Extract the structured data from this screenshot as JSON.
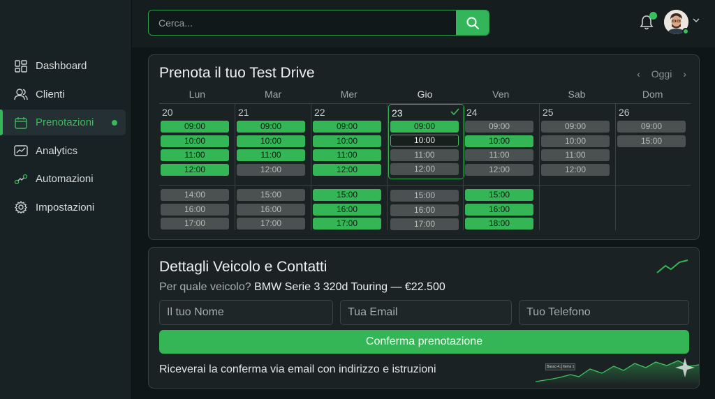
{
  "search": {
    "placeholder": "Cerca..."
  },
  "sidebar": {
    "items": [
      {
        "label": "Dashboard",
        "icon": "dashboard-icon",
        "active": false
      },
      {
        "label": "Clienti",
        "icon": "users-icon",
        "active": false
      },
      {
        "label": "Prenotazioni",
        "icon": "calendar-icon",
        "active": true
      },
      {
        "label": "Analytics",
        "icon": "analytics-icon",
        "active": false
      },
      {
        "label": "Automazioni",
        "icon": "automation-icon",
        "active": false
      },
      {
        "label": "Impostazioni",
        "icon": "gear-icon",
        "active": false
      }
    ]
  },
  "calendar": {
    "title": "Prenota il tuo Test Drive",
    "today_label": "Oggi",
    "prev_icon": "chevron-left-icon",
    "next_icon": "chevron-right-icon",
    "days": [
      {
        "name": "Lun",
        "num": "20",
        "morning": [
          [
            "09:00",
            "avail"
          ],
          [
            "10:00",
            "avail"
          ],
          [
            "11:00",
            "avail"
          ],
          [
            "12:00",
            "avail"
          ]
        ],
        "afternoon": [
          [
            "14:00",
            "busy"
          ],
          [
            "16:00",
            "busy"
          ],
          [
            "17:00",
            "busy"
          ]
        ]
      },
      {
        "name": "Mar",
        "num": "21",
        "morning": [
          [
            "09:00",
            "avail"
          ],
          [
            "10:00",
            "avail"
          ],
          [
            "11:00",
            "avail"
          ],
          [
            "12:00",
            "busy"
          ]
        ],
        "afternoon": [
          [
            "15:00",
            "busy"
          ],
          [
            "16:00",
            "busy"
          ],
          [
            "17:00",
            "busy"
          ]
        ]
      },
      {
        "name": "Mer",
        "num": "22",
        "morning": [
          [
            "09:00",
            "avail"
          ],
          [
            "10:00",
            "avail"
          ],
          [
            "11:00",
            "avail"
          ],
          [
            "12:00",
            "avail"
          ]
        ],
        "afternoon": [
          [
            "15:00",
            "avail"
          ],
          [
            "16:00",
            "avail"
          ],
          [
            "17:00",
            "avail"
          ]
        ]
      },
      {
        "name": "Gio",
        "num": "23",
        "selected": true,
        "morning": [
          [
            "09:00",
            "avail"
          ],
          [
            "10:00",
            "selected"
          ],
          [
            "11:00",
            "busy"
          ],
          [
            "12:00",
            "busy"
          ]
        ],
        "afternoon": [
          [
            "15:00",
            "busy"
          ],
          [
            "16:00",
            "busy"
          ],
          [
            "17:00",
            "busy"
          ]
        ]
      },
      {
        "name": "Ven",
        "num": "24",
        "morning": [
          [
            "09:00",
            "busy"
          ],
          [
            "10:00",
            "avail"
          ],
          [
            "11:00",
            "busy"
          ],
          [
            "12:00",
            "busy"
          ]
        ],
        "afternoon": [
          [
            "15:00",
            "avail"
          ],
          [
            "16:00",
            "avail"
          ],
          [
            "18:00",
            "avail"
          ]
        ]
      },
      {
        "name": "Sab",
        "num": "25",
        "morning": [
          [
            "09:00",
            "busy"
          ],
          [
            "10:00",
            "busy"
          ],
          [
            "11:00",
            "busy"
          ],
          [
            "12:00",
            "busy"
          ]
        ],
        "afternoon": []
      },
      {
        "name": "Dom",
        "num": "26",
        "morning": [
          [
            "09:00",
            "busy"
          ],
          [
            "15:00",
            "busy"
          ]
        ],
        "afternoon": []
      }
    ]
  },
  "form": {
    "title": "Dettagli Veicolo e Contatti",
    "vehicle_question": "Per quale veicolo?",
    "vehicle_value": "BMW Serie 3 320d Touring — €22.500",
    "name_placeholder": "Il tuo Nome",
    "email_placeholder": "Tua Email",
    "phone_placeholder": "Tuo Telefono",
    "confirm_label": "Conferma prenotazione",
    "note": "Riceverai la conferma via email con indirizzo e istruzioni",
    "chart_labels": [
      "Basso 4.23",
      "Items 1"
    ]
  },
  "colors": {
    "accent": "#34b556",
    "background": "#131a1c",
    "card": "#1b2224",
    "busy": "#4a5150"
  }
}
